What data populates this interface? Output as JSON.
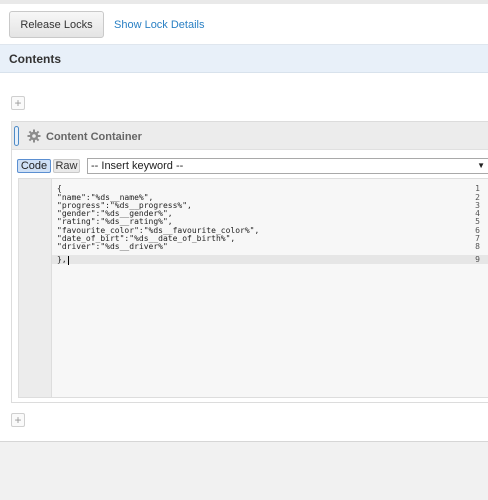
{
  "toolbar": {
    "release_locks_label": "Release Locks",
    "show_lock_details_label": "Show Lock Details"
  },
  "contents": {
    "title": "Contents",
    "add_symbol": "+"
  },
  "container": {
    "title": "Content Container",
    "code_button": "Code",
    "raw_button": "Raw",
    "keyword_select": "-- Insert keyword --",
    "select_arrow": "▼"
  },
  "editor": {
    "line_numbers": [
      "1",
      "2",
      "3",
      "4",
      "5",
      "6",
      "7",
      "8",
      "9"
    ],
    "lines": [
      "{",
      "\"name\":\"%ds__name%\",",
      "\"progress\":\"%ds__progress%\",",
      "\"gender\":\"%ds__gender%\",",
      "\"rating\":\"%ds__rating%\",",
      "\"favourite_color\":\"%ds__favourite_color%\",",
      "\"date_of_birt\":\"%ds__date_of_birth%\",",
      "\"driver\":\"%ds__driver%\"",
      "},"
    ],
    "active_line": 9
  },
  "icons": {
    "gear": "gear-icon",
    "drag": "drag-handle-icon",
    "plus": "plus-icon",
    "dropdown": "chevron-down-icon"
  },
  "colors": {
    "link": "#2a80c4",
    "contents_bar": "#e8f0f9",
    "code_button_active": "#cfe0f5"
  }
}
